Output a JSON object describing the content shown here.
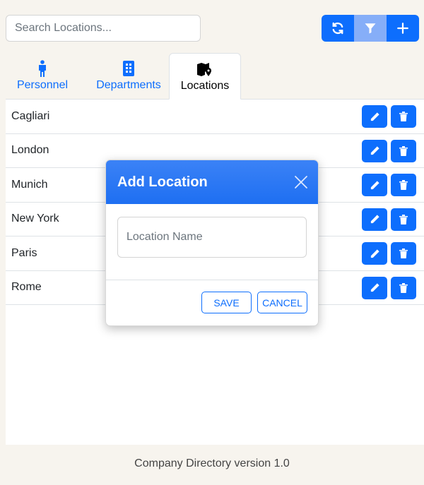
{
  "search": {
    "placeholder": "Search Locations..."
  },
  "toolbar": {
    "refresh_icon": "refresh-icon",
    "filter_icon": "filter-icon",
    "add_icon": "plus-icon"
  },
  "tabs": [
    {
      "label": "Personnel",
      "icon": "person-icon",
      "active": false
    },
    {
      "label": "Departments",
      "icon": "building-icon",
      "active": false
    },
    {
      "label": "Locations",
      "icon": "map-pin-icon",
      "active": true
    }
  ],
  "locations": [
    "Cagliari",
    "London",
    "Munich",
    "New York",
    "Paris",
    "Rome"
  ],
  "modal": {
    "title": "Add Location",
    "input_placeholder": "Location Name",
    "save_label": "SAVE",
    "cancel_label": "CANCEL"
  },
  "footer": {
    "text": "Company Directory version 1.0"
  },
  "colors": {
    "primary": "#0d6efd",
    "primary_light": "#86aef8",
    "background": "#f7f4ee"
  }
}
